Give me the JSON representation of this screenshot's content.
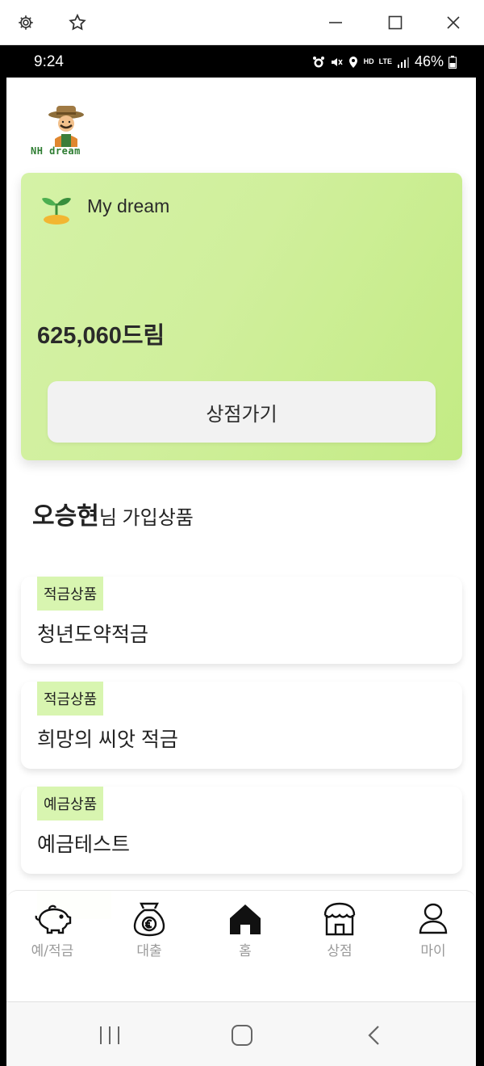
{
  "window": {
    "icons": [
      "gear-icon",
      "star-icon",
      "minimize-icon",
      "maximize-icon",
      "close-icon"
    ]
  },
  "status_bar": {
    "time": "9:24",
    "hd": "HD",
    "lte": "LTE",
    "battery": "46%"
  },
  "header": {
    "logo_text": "NH dream"
  },
  "dream_card": {
    "title": "My dream",
    "points": "625,060드림",
    "shop_button": "상점가기",
    "bg_color": "#c8ee8e"
  },
  "subscriptions": {
    "user_name": "오승현",
    "title_suffix": "님 가입상품",
    "items": [
      {
        "tag": "적금상품",
        "name": "청년도약적금"
      },
      {
        "tag": "적금상품",
        "name": "희망의 씨앗 적금"
      },
      {
        "tag": "예금상품",
        "name": "예금테스트"
      }
    ]
  },
  "bottom_nav": {
    "items": [
      {
        "label": "예/적금",
        "icon": "piggy-bank-icon"
      },
      {
        "label": "대출",
        "icon": "money-bag-icon"
      },
      {
        "label": "홈",
        "icon": "home-icon"
      },
      {
        "label": "상점",
        "icon": "store-icon"
      },
      {
        "label": "마이",
        "icon": "user-icon"
      }
    ]
  },
  "system_nav": {
    "icons": [
      "recents-icon",
      "home-button-icon",
      "back-icon"
    ]
  }
}
